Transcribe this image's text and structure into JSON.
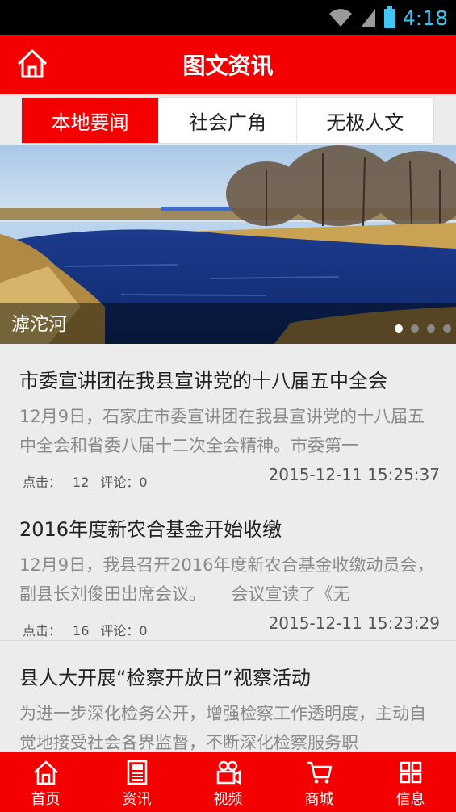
{
  "status_bar": {
    "time": "4:18"
  },
  "header": {
    "title": "图文资讯",
    "home_icon": "home-icon"
  },
  "tabs": [
    {
      "label": "本地要闻",
      "active": true
    },
    {
      "label": "社会广角",
      "active": false
    },
    {
      "label": "无极人文",
      "active": false
    }
  ],
  "banner": {
    "caption": "滹沱河",
    "slide_count": 4,
    "active_slide": 1
  },
  "news": [
    {
      "title": "市委宣讲团在我县宣讲党的十八届五中全会",
      "summary": "12月9日，石家庄市委宣讲团在我县宣讲党的十八届五中全会和省委八届十二次全会精神。市委第一",
      "clicks_label": "点击：",
      "clicks": "12",
      "comments": "评论：0",
      "date": "2015-12-11 15:25:37"
    },
    {
      "title": "2016年度新农合基金开始收缴",
      "summary": "12月9日，我县召开2016年度新农合基金收缴动员会，副县长刘俊田出席会议。　　会议宣读了《无",
      "clicks_label": "点击：",
      "clicks": "16",
      "comments": "评论：0",
      "date": "2015-12-11 15:23:29"
    },
    {
      "title": "县人大开展“检察开放日”视察活动",
      "summary": "为进一步深化检务公开，增强检察工作透明度，主动自觉地接受社会各界监督，不断深化检察服务职",
      "clicks_label": "",
      "clicks": "",
      "comments": "",
      "date": ""
    }
  ],
  "bottom_nav": [
    {
      "label": "首页",
      "icon": "home-icon"
    },
    {
      "label": "资讯",
      "icon": "news-icon"
    },
    {
      "label": "视频",
      "icon": "video-camera-icon"
    },
    {
      "label": "商城",
      "icon": "shopping-cart-icon"
    },
    {
      "label": "信息",
      "icon": "grid-icon"
    }
  ],
  "colors": {
    "brand": "#f40000",
    "status_time": "#3ec7f2"
  }
}
